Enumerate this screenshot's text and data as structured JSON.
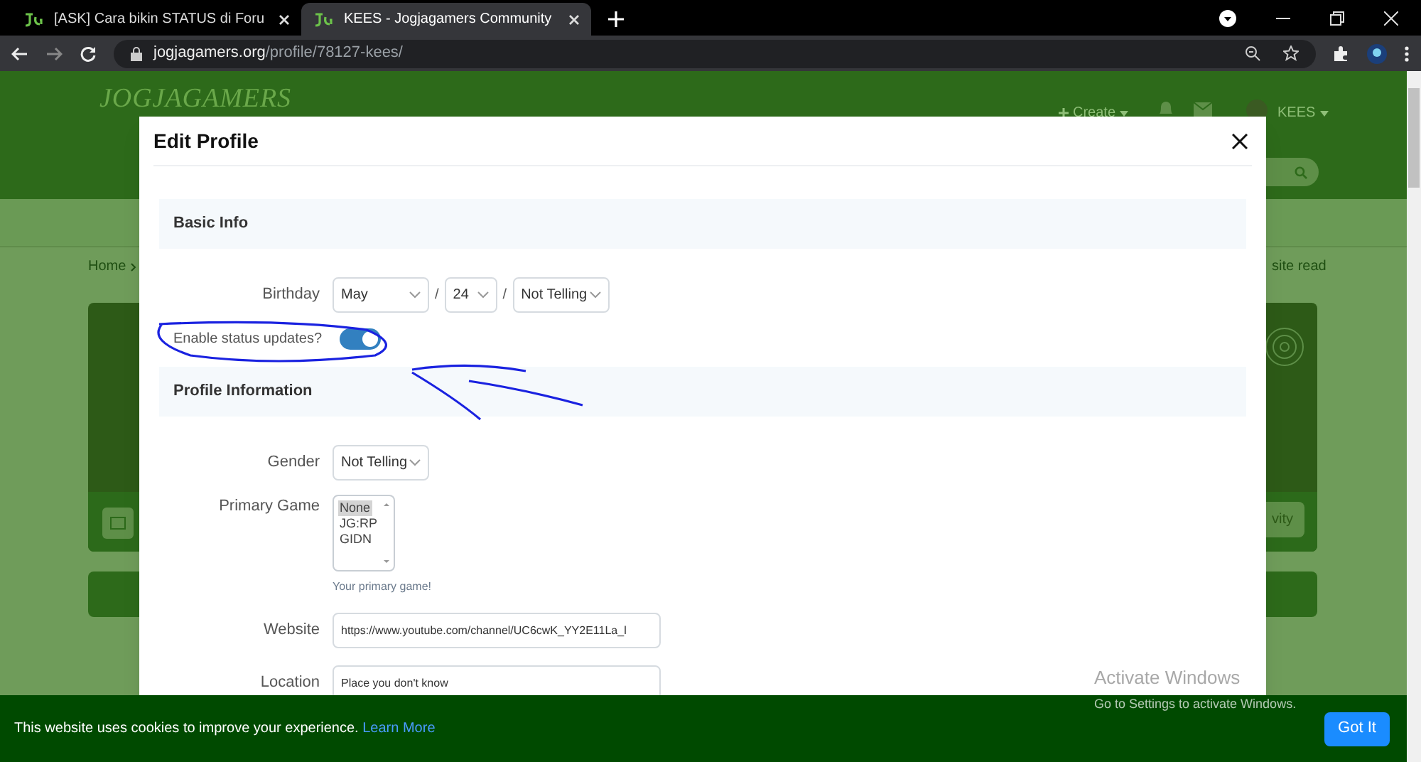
{
  "browser": {
    "tabs": [
      {
        "title": "[ASK] Cara bikin STATUS di Foru",
        "selected": false
      },
      {
        "title": "KEES - Jogjagamers Community",
        "selected": true
      }
    ],
    "url_host": "jogjagamers.org",
    "url_path": "/profile/78127-kees/"
  },
  "site": {
    "logo": "JOGJAGAMERS",
    "create": "Create",
    "user": "KEES",
    "breadcrumb": "Home",
    "breadcrumb_right": "site read",
    "activity_button": "vity"
  },
  "modal": {
    "title": "Edit Profile",
    "sections": [
      {
        "title": "Basic Info",
        "fields": [
          {
            "kind": "date",
            "label": "Birthday",
            "parts": [
              "May",
              "24",
              "Not Telling"
            ],
            "separator": "/"
          },
          {
            "kind": "toggle",
            "label": "Enable status updates?",
            "on": true
          }
        ]
      },
      {
        "title": "Profile Information",
        "fields": [
          {
            "kind": "select",
            "label": "Gender",
            "value": "Not Telling"
          },
          {
            "kind": "listbox",
            "label": "Primary Game",
            "options": [
              {
                "label": "None",
                "selected": true
              },
              {
                "label": "JG:RP",
                "selected": false
              },
              {
                "label": "GIDN",
                "selected": false
              }
            ],
            "hint": "Your primary game!"
          },
          {
            "kind": "text",
            "label": "Website",
            "value": "https://www.youtube.com/channel/UC6cwK_YY2E11La_l"
          },
          {
            "kind": "text",
            "label": "Location",
            "value": "Place you don't know"
          }
        ]
      }
    ]
  },
  "cookie_bar": {
    "message": "This website uses cookies to improve your experience.",
    "link": "Learn More",
    "button": "Got It"
  },
  "os_watermark": {
    "title": "Activate Windows",
    "subtitle": "Go to Settings to activate Windows."
  }
}
